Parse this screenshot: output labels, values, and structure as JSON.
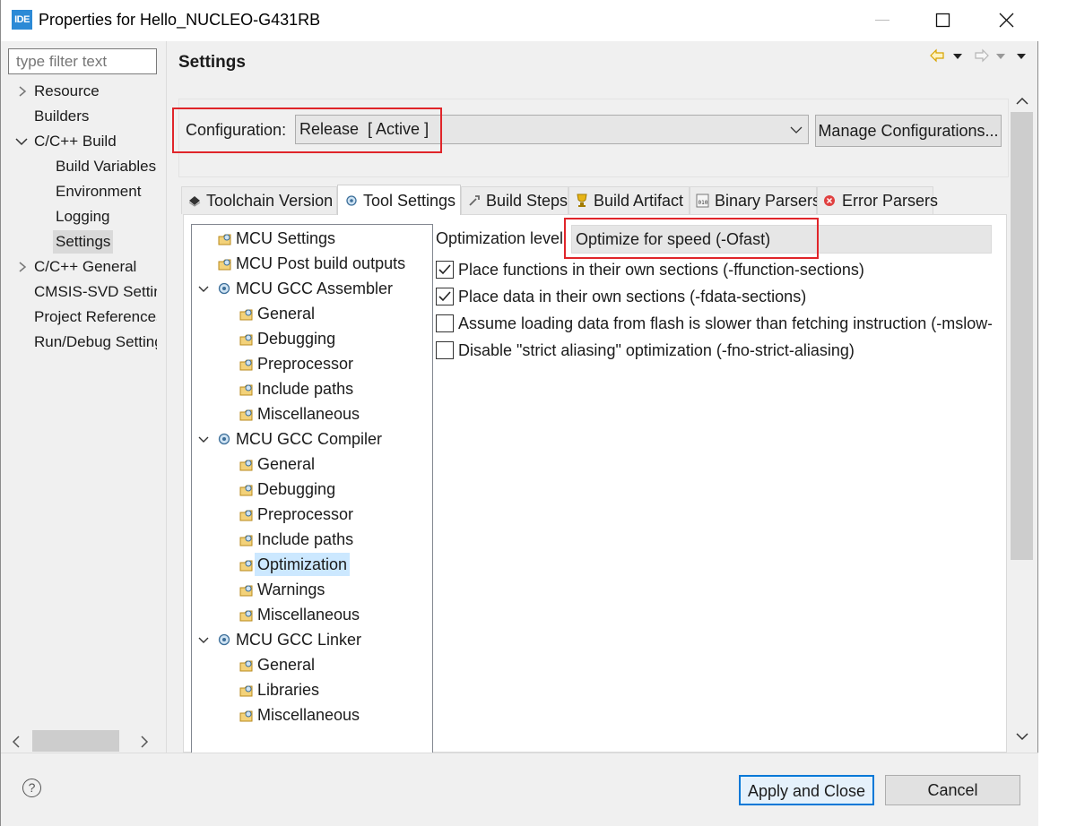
{
  "window": {
    "app_icon_text": "IDE",
    "title": "Properties for Hello_NUCLEO-G431RB"
  },
  "filter": {
    "placeholder": "type filter text"
  },
  "nav": {
    "items": [
      {
        "label": "Resource",
        "expandable": true,
        "expanded": false
      },
      {
        "label": "Builders"
      },
      {
        "label": "C/C++ Build",
        "expandable": true,
        "expanded": true
      },
      {
        "label": "Build Variables"
      },
      {
        "label": "Environment"
      },
      {
        "label": "Logging"
      },
      {
        "label": "Settings",
        "selected": true
      },
      {
        "label": "C/C++ General",
        "expandable": true,
        "expanded": false
      },
      {
        "label": "CMSIS-SVD Settings"
      },
      {
        "label": "Project References"
      },
      {
        "label": "Run/Debug Settings"
      }
    ]
  },
  "page": {
    "title": "Settings"
  },
  "config": {
    "label": "Configuration:",
    "value": "Release  [ Active ]",
    "manage_button": "Manage Configurations..."
  },
  "tabs": [
    {
      "label": "Toolchain  Version",
      "icon": "toolchain-icon"
    },
    {
      "label": "Tool Settings",
      "icon": "gear-icon",
      "active": true
    },
    {
      "label": "Build Steps",
      "icon": "wrench-icon"
    },
    {
      "label": "Build Artifact",
      "icon": "trophy-icon"
    },
    {
      "label": "Binary Parsers",
      "icon": "binary-icon"
    },
    {
      "label": "Error Parsers",
      "icon": "error-icon"
    }
  ],
  "tool_tree": {
    "items": [
      {
        "label": "MCU Settings"
      },
      {
        "label": "MCU Post build outputs"
      },
      {
        "label": "MCU GCC Assembler",
        "expanded": true
      },
      {
        "label": "General"
      },
      {
        "label": "Debugging"
      },
      {
        "label": "Preprocessor"
      },
      {
        "label": "Include paths"
      },
      {
        "label": "Miscellaneous"
      },
      {
        "label": "MCU GCC Compiler",
        "expanded": true
      },
      {
        "label": "General"
      },
      {
        "label": "Debugging"
      },
      {
        "label": "Preprocessor"
      },
      {
        "label": "Include paths"
      },
      {
        "label": "Optimization",
        "selected": true
      },
      {
        "label": "Warnings"
      },
      {
        "label": "Miscellaneous"
      },
      {
        "label": "MCU GCC Linker",
        "expanded": true
      },
      {
        "label": "General"
      },
      {
        "label": "Libraries"
      },
      {
        "label": "Miscellaneous"
      }
    ]
  },
  "optimization": {
    "label": "Optimization level",
    "value": "Optimize for speed (-Ofast)",
    "options": [
      {
        "label": "Place functions in their own sections (-ffunction-sections)",
        "checked": true
      },
      {
        "label": "Place data in their own sections (-fdata-sections)",
        "checked": true
      },
      {
        "label": "Assume loading data from flash is slower than fetching instruction (-mslow-flash-data)",
        "checked": false
      },
      {
        "label": "Disable \"strict aliasing\" optimization (-fno-strict-aliasing)",
        "checked": false
      }
    ]
  },
  "footer": {
    "apply_close": "Apply and Close",
    "cancel": "Cancel",
    "help_symbol": "?"
  },
  "colors": {
    "highlight_red": "#e0252a",
    "selection_blue": "#cce8ff",
    "focus_blue": "#0078d7"
  }
}
